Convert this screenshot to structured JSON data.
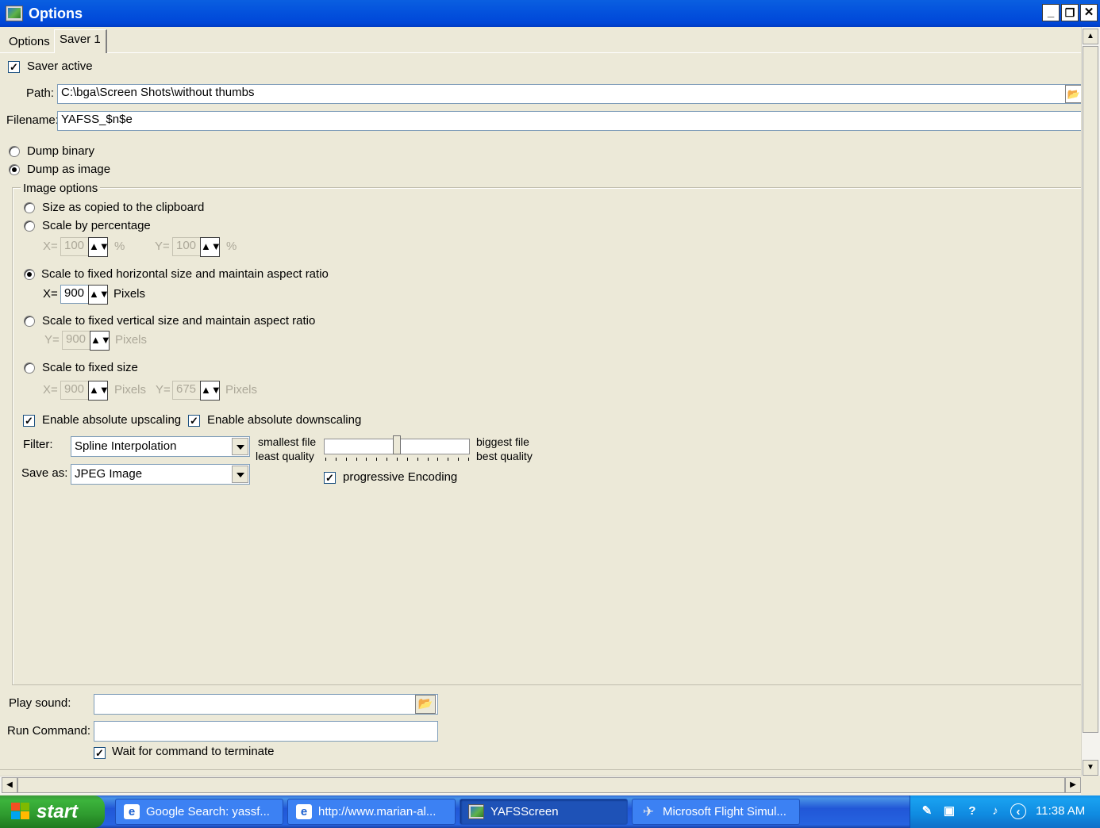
{
  "window": {
    "title": "Options",
    "buttons": {
      "minimize": "_",
      "restore": "❐",
      "close": "✕"
    }
  },
  "tabs": [
    {
      "label": "Options",
      "selected": false
    },
    {
      "label": "Saver 1",
      "selected": true
    }
  ],
  "saver": {
    "active_label": "Saver active",
    "active_checked": true,
    "path_label": "Path:",
    "path_value": "C:\\bga\\Screen Shots\\without thumbs",
    "filename_label": "Filename:",
    "filename_value": "YAFSS_$n$e",
    "dump_binary_label": "Dump binary",
    "dump_image_label": "Dump as image",
    "dump_mode": "image"
  },
  "image_options": {
    "group_label": "Image options",
    "size_clipboard_label": "Size as copied to the clipboard",
    "scale_percent_label": "Scale by percentage",
    "percent": {
      "x_label": "X=",
      "x_value": "100",
      "x_unit": "%",
      "y_label": "Y=",
      "y_value": "100",
      "y_unit": "%"
    },
    "fixed_h_label": "Scale to fixed horizontal size and maintain aspect ratio",
    "fixed_h": {
      "x_label": "X=",
      "x_value": "900",
      "unit": "Pixels"
    },
    "fixed_v_label": "Scale to fixed vertical size and maintain aspect ratio",
    "fixed_v": {
      "y_label": "Y=",
      "y_value": "900",
      "unit": "Pixels"
    },
    "fixed_size_label": "Scale to fixed size",
    "fixed_size": {
      "x_label": "X=",
      "x_value": "900",
      "x_unit": "Pixels",
      "y_label": "Y=",
      "y_value": "675",
      "y_unit": "Pixels"
    },
    "selected_mode": "fixed_horizontal",
    "upscaling_label": "Enable absolute upscaling",
    "upscaling_checked": true,
    "downscaling_label": "Enable absolute downscaling",
    "downscaling_checked": true,
    "filter_label": "Filter:",
    "filter_value": "Spline Interpolation",
    "save_as_label": "Save as:",
    "save_as_value": "JPEG Image",
    "quality_left_1": "smallest file",
    "quality_left_2": "least quality",
    "quality_right_1": "biggest file",
    "quality_right_2": "best quality",
    "quality_level": 0.5,
    "progressive_label": "progressive Encoding",
    "progressive_checked": true
  },
  "bottom": {
    "play_sound_label": "Play sound:",
    "play_sound_value": "",
    "run_command_label": "Run Command:",
    "run_command_value": "",
    "wait_label": "Wait for command to terminate",
    "wait_checked": true
  },
  "icons": {
    "app": "camera-app-icon",
    "folder": "open-folder-icon",
    "spin": "up-down-spinner-icon"
  },
  "taskbar": {
    "start_label": "start",
    "tasks": [
      {
        "label": "Google Search: yassf...",
        "icon": "ie-icon",
        "active": false
      },
      {
        "label": "http://www.marian-al...",
        "icon": "ie-icon",
        "active": false
      },
      {
        "label": "YAFSScreen",
        "icon": "yafs-icon",
        "active": true
      },
      {
        "label": "Microsoft Flight Simul...",
        "icon": "airplane-icon",
        "active": false
      }
    ],
    "clock": "11:38 AM"
  },
  "colors": {
    "titlebar": "#0453dd",
    "window_bg": "#ece9d8",
    "taskbar": "#2157d7",
    "start": "#3cb43c",
    "tray": "#0f8ae0"
  }
}
